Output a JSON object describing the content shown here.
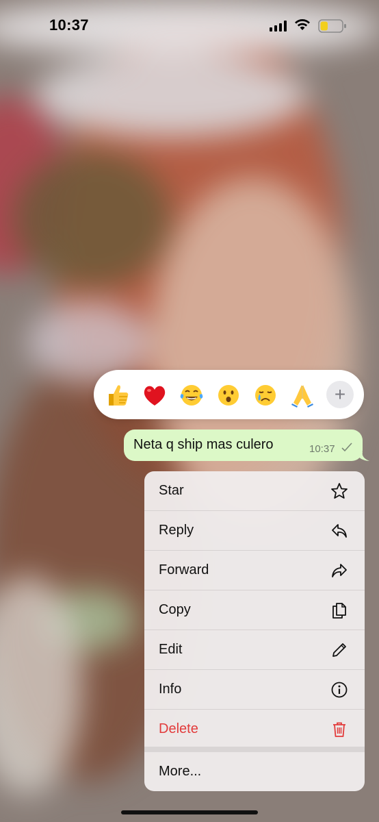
{
  "status_bar": {
    "time": "10:37",
    "battery_percent": 35
  },
  "reactions": {
    "emojis": [
      "thumbs-up",
      "red-heart",
      "tears-of-joy",
      "surprised-face",
      "crying-face",
      "folded-hands"
    ],
    "more_label": "+"
  },
  "message": {
    "text": "Neta q ship mas culero",
    "time": "10:37",
    "status": "sent"
  },
  "menu": {
    "items": [
      {
        "label": "Star",
        "icon": "star-icon"
      },
      {
        "label": "Reply",
        "icon": "reply-icon"
      },
      {
        "label": "Forward",
        "icon": "forward-icon"
      },
      {
        "label": "Copy",
        "icon": "copy-icon"
      },
      {
        "label": "Edit",
        "icon": "pencil-icon"
      },
      {
        "label": "Info",
        "icon": "info-icon"
      },
      {
        "label": "Delete",
        "icon": "trash-icon"
      },
      {
        "label": "More...",
        "icon": ""
      }
    ]
  },
  "colors": {
    "bubble": "#dcf8c7",
    "danger": "#e23b3b",
    "accent": "#25d366"
  }
}
